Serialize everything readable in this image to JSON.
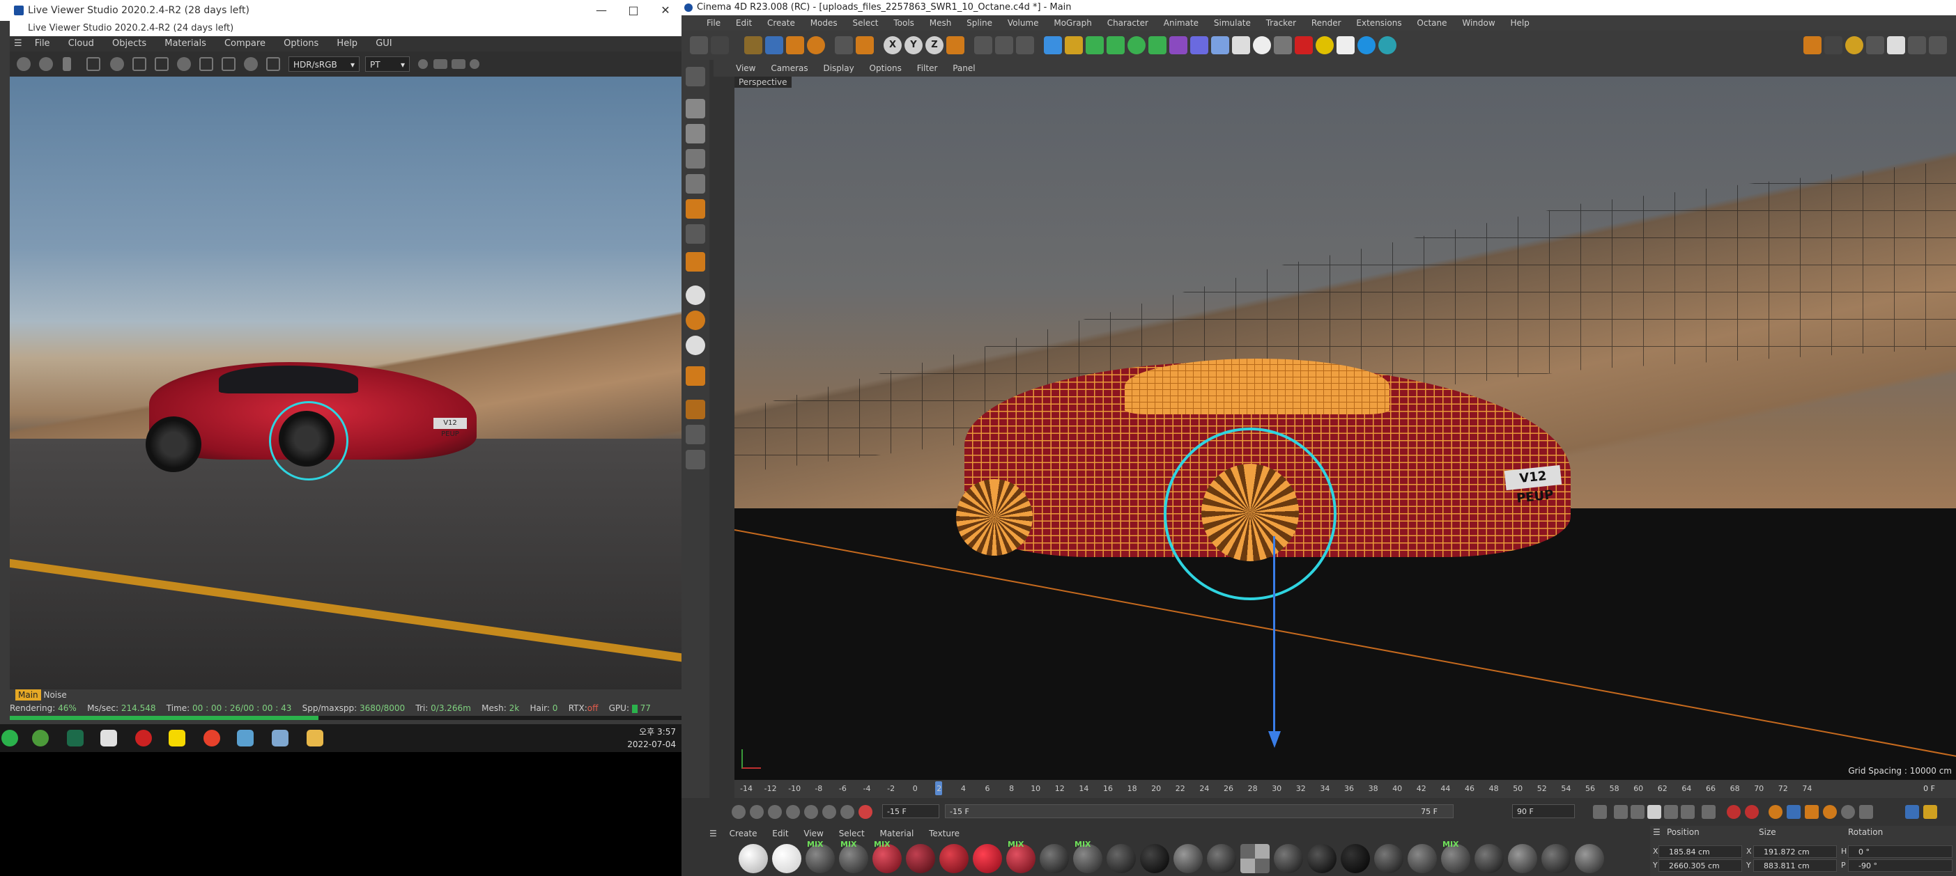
{
  "live_viewer": {
    "title": "Live Viewer Studio 2020.2.4-R2 (28 days left)",
    "subtitle": "Live Viewer Studio 2020.2.4-R2 (24 days left)",
    "menu": [
      "File",
      "Cloud",
      "Objects",
      "Materials",
      "Compare",
      "Options",
      "Help",
      "GUI"
    ],
    "dropdown_colorspace": "HDR/sRGB",
    "dropdown_kernel": "PT",
    "plate_text": "V12 PEUP",
    "channel_main": "Main",
    "channel_noise": "Noise",
    "status": {
      "rendering_label": "Rendering:",
      "rendering_value": "46%",
      "ms_label": "Ms/sec:",
      "ms_value": "214.548",
      "time_label": "Time:",
      "time_value": "00 : 00 : 26/00 : 00 : 43",
      "spp_label": "Spp/maxspp:",
      "spp_value": "3680/8000",
      "tri_label": "Tri:",
      "tri_value": "0/3.266m",
      "mesh_label": "Mesh:",
      "mesh_value": "2k",
      "hair_label": "Hair:",
      "hair_value": "0",
      "rtx_label": "RTX:",
      "rtx_value": "off",
      "gpu_label": "GPU:",
      "gpu_value": "77"
    },
    "progress": 0.46
  },
  "taskbar": {
    "time": "오후 3:57",
    "date": "2022-07-04"
  },
  "c4d": {
    "title": "Cinema 4D R23.008 (RC) - [uploads_files_2257863_SWR1_10_Octane.c4d *] - Main",
    "menu": [
      "File",
      "Edit",
      "Create",
      "Modes",
      "Select",
      "Tools",
      "Mesh",
      "Spline",
      "Volume",
      "MoGraph",
      "Character",
      "Animate",
      "Simulate",
      "Tracker",
      "Render",
      "Extensions",
      "Octane",
      "Window",
      "Help"
    ],
    "toolbar_xyz": [
      "X",
      "Y",
      "Z"
    ],
    "view_menu": [
      "View",
      "Cameras",
      "Display",
      "Options",
      "Filter",
      "Panel"
    ],
    "viewport_label": "Perspective",
    "plate_text": "V12 PEUP",
    "grid_spacing": "Grid Spacing : 10000 cm",
    "timeline_ticks": [
      "-14",
      "-12",
      "-10",
      "-8",
      "-6",
      "-4",
      "-2",
      "0",
      "2",
      "4",
      "6",
      "8",
      "10",
      "12",
      "14",
      "16",
      "18",
      "20",
      "22",
      "24",
      "26",
      "28",
      "30",
      "32",
      "34",
      "36",
      "38",
      "40",
      "42",
      "44",
      "46",
      "48",
      "50",
      "52",
      "54",
      "56",
      "58",
      "60",
      "62",
      "64",
      "66",
      "68",
      "70",
      "72",
      "74"
    ],
    "timeline_end": "0 F",
    "transport": {
      "start_field": "-15 F",
      "range_start": "-15 F",
      "range_end": "75 F",
      "end_field": "90 F"
    },
    "material_menu": [
      "Create",
      "Edit",
      "View",
      "Select",
      "Material",
      "Texture"
    ],
    "material_mix_label": "MIX",
    "coords": {
      "position_label": "Position",
      "size_label": "Size",
      "rotation_label": "Rotation",
      "pos_x": "185.84 cm",
      "pos_y": "2660.305 cm",
      "size_x": "191.872 cm",
      "size_y": "883.811 cm",
      "rot_h": "0 °",
      "rot_p": "-90 °",
      "axis_x": "X",
      "axis_y": "Y",
      "axis_h": "H",
      "axis_p": "P"
    }
  }
}
